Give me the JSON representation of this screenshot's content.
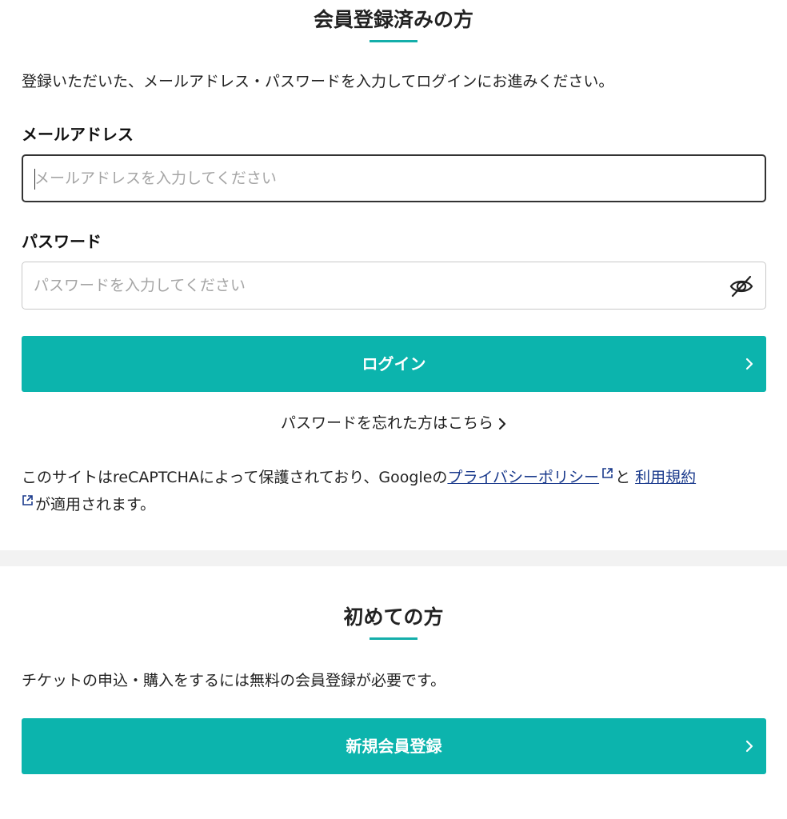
{
  "member": {
    "title": "会員登録済みの方",
    "intro": "登録いただいた、メールアドレス・パスワードを入力してログインにお進みください。",
    "email_label": "メールアドレス",
    "email_placeholder": "メールアドレスを入力してください",
    "email_value": "",
    "password_label": "パスワード",
    "password_placeholder": "パスワードを入力してください",
    "password_value": "",
    "login_label": "ログイン",
    "forgot_label": "パスワードを忘れた方はこちら",
    "recaptcha_prefix": "このサイトはreCAPTCHAによって保護されており、Googleの",
    "privacy_link": "プライバシーポリシー",
    "and_text": "と ",
    "terms_link": "利用規約",
    "recaptcha_suffix": "が適用されます。"
  },
  "new_user": {
    "title": "初めての方",
    "intro": "チケットの申込・購入をするには無料の会員登録が必要です。",
    "register_label": "新規会員登録"
  },
  "colors": {
    "accent": "#0cb4ad",
    "link": "#1a3a8c",
    "divider": "#f2f2f2"
  },
  "icons": {
    "password_toggle": "eye-slash-icon",
    "button_chevron": "chevron-right-icon",
    "external_link": "external-link-icon"
  }
}
